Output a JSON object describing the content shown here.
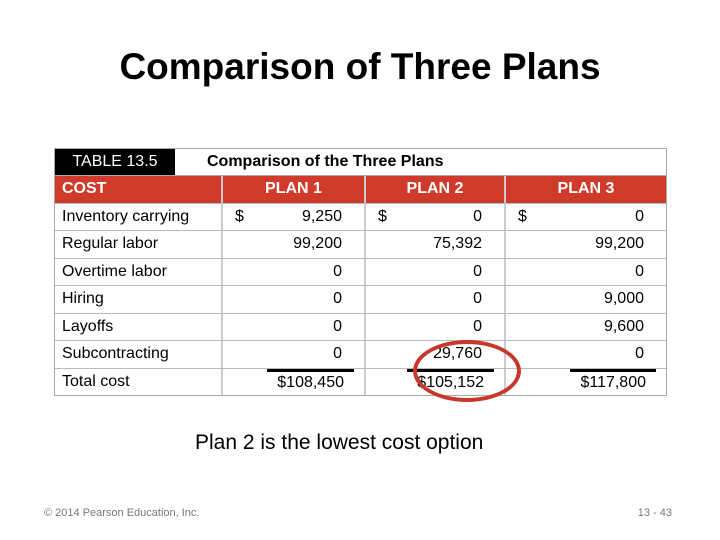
{
  "slide": {
    "title": "Comparison of Three Plans",
    "note": "Plan 2 is the lowest cost option",
    "copyright": "© 2014 Pearson Education, Inc.",
    "page": "13 - 43",
    "highlight_color": "#c8372c"
  },
  "table": {
    "number": "TABLE 13.5",
    "caption": "Comparison of the Three Plans",
    "header_color": "#d03a2a",
    "headers": [
      "COST",
      "PLAN 1",
      "PLAN 2",
      "PLAN 3"
    ],
    "rows": [
      {
        "label": "Inventory carrying",
        "p1": "9,250",
        "p2": "0",
        "p3": "0",
        "currency": "$"
      },
      {
        "label": "Regular labor",
        "p1": "99,200",
        "p2": "75,392",
        "p3": "99,200"
      },
      {
        "label": "Overtime labor",
        "p1": "0",
        "p2": "0",
        "p3": "0"
      },
      {
        "label": "Hiring",
        "p1": "0",
        "p2": "0",
        "p3": "9,000"
      },
      {
        "label": "Layoffs",
        "p1": "0",
        "p2": "0",
        "p3": "9,600"
      },
      {
        "label": "Subcontracting",
        "p1": "0",
        "p2": "29,760",
        "p3": "0"
      },
      {
        "label": "Total cost",
        "p1": "$108,450",
        "p2": "$105,152",
        "p3": "$117,800"
      }
    ]
  }
}
